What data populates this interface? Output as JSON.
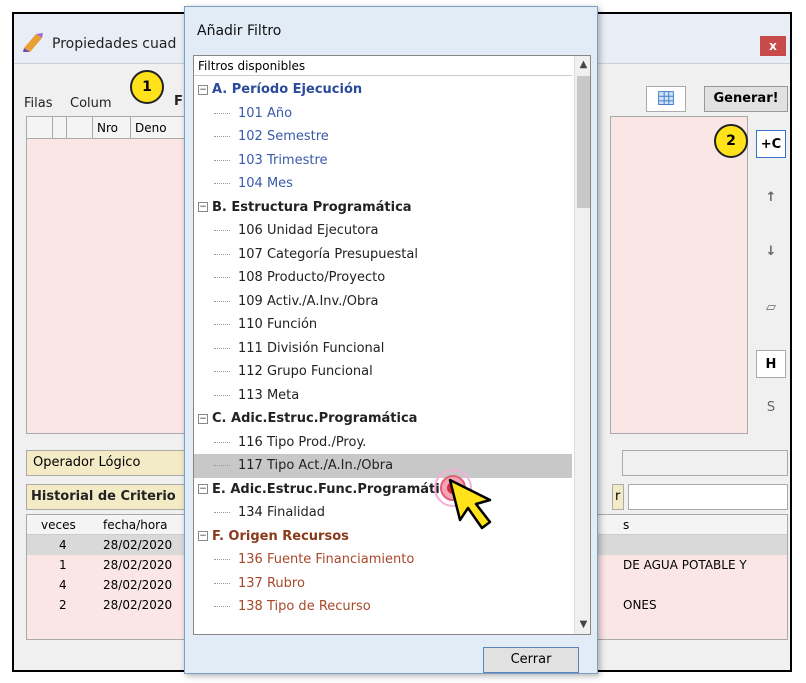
{
  "window": {
    "title": "Propiedades cuad",
    "close_label": "x",
    "tabs": [
      "Filas",
      "Colum",
      "Fil"
    ],
    "generate_label": "Generar!",
    "badge1": "1",
    "badge2": "2",
    "left_headers": [
      "",
      "",
      "Nro",
      "Deno"
    ],
    "side_tools": [
      "+C",
      "↑",
      "↓",
      "▱",
      "H",
      "S"
    ],
    "operator_label": "Operador Lógico",
    "history_label": "Historial de Criterio",
    "history_right_label": "r",
    "history_headers": [
      "veces",
      "fecha/hora",
      "s"
    ],
    "history_rows": [
      {
        "veces": "4",
        "fecha": "28/02/2020",
        "desc": ""
      },
      {
        "veces": "1",
        "fecha": "28/02/2020",
        "desc": "DE AGUA POTABLE Y"
      },
      {
        "veces": "4",
        "fecha": "28/02/2020",
        "desc": ""
      },
      {
        "veces": "2",
        "fecha": "28/02/2020",
        "desc": "ONES"
      }
    ]
  },
  "dialog": {
    "title": "Añadir Filtro",
    "list_header": "Filtros disponibles",
    "close_button": "Cerrar",
    "items": [
      {
        "type": "group",
        "text": "A. Período Ejecución",
        "style": "grpA"
      },
      {
        "type": "leaf",
        "text": "101 Año",
        "style": "blue"
      },
      {
        "type": "leaf",
        "text": "102 Semestre",
        "style": "blue"
      },
      {
        "type": "leaf",
        "text": "103 Trimestre",
        "style": "blue"
      },
      {
        "type": "leaf",
        "text": "104 Mes",
        "style": "blue"
      },
      {
        "type": "group",
        "text": "B. Estructura Programática",
        "style": "dark"
      },
      {
        "type": "leaf",
        "text": "106 Unidad Ejecutora",
        "style": "dark"
      },
      {
        "type": "leaf",
        "text": "107 Categoría Presupuestal",
        "style": "dark"
      },
      {
        "type": "leaf",
        "text": "108 Producto/Proyecto",
        "style": "dark"
      },
      {
        "type": "leaf",
        "text": "109 Activ./A.Inv./Obra",
        "style": "dark"
      },
      {
        "type": "leaf",
        "text": "110 Función",
        "style": "dark"
      },
      {
        "type": "leaf",
        "text": "111 División Funcional",
        "style": "dark"
      },
      {
        "type": "leaf",
        "text": "112 Grupo Funcional",
        "style": "dark"
      },
      {
        "type": "leaf",
        "text": "113 Meta",
        "style": "dark"
      },
      {
        "type": "group",
        "text": "C. Adic.Estruc.Programática",
        "style": "dark"
      },
      {
        "type": "leaf",
        "text": "116 Tipo Prod./Proy.",
        "style": "dark"
      },
      {
        "type": "leaf",
        "text": "117 Tipo Act./A.In./Obra",
        "style": "dark",
        "selected": true
      },
      {
        "type": "group",
        "text": "E. Adic.Estruc.Func.Programática",
        "style": "dark"
      },
      {
        "type": "leaf",
        "text": "134 Finalidad",
        "style": "dark"
      },
      {
        "type": "group",
        "text": "F. Origen Recursos",
        "style": "grp"
      },
      {
        "type": "leaf",
        "text": "136 Fuente Financiamiento",
        "style": "orange"
      },
      {
        "type": "leaf",
        "text": "137 Rubro",
        "style": "orange"
      },
      {
        "type": "leaf",
        "text": "138 Tipo de Recurso",
        "style": "orange"
      }
    ]
  },
  "colors": {
    "accent": "#3a5aa8",
    "badge": "#ffe21a",
    "panel_pink": "#fbe6e6",
    "selection": "#c8c8c8"
  }
}
